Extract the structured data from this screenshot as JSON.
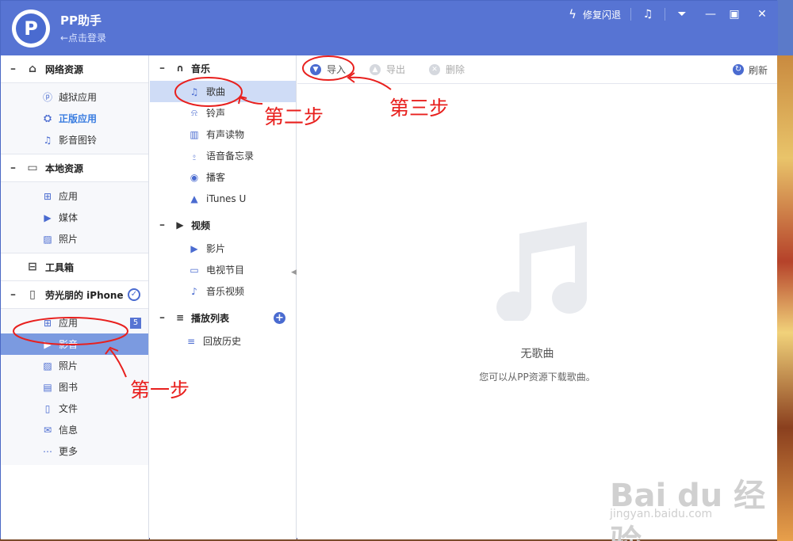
{
  "app": {
    "title": "PP助手",
    "login": "←点击登录"
  },
  "titlebar": {
    "flash_fix": "修复闪退"
  },
  "sidebar": {
    "sections": [
      {
        "label": "网络资源",
        "items": [
          "越狱应用",
          "正版应用",
          "影音图铃"
        ]
      },
      {
        "label": "本地资源",
        "items": [
          "应用",
          "媒体",
          "照片"
        ]
      },
      {
        "label": "工具箱"
      },
      {
        "label": "劳光朋的 iPhone",
        "items": [
          "应用",
          "影音",
          "照片",
          "图书",
          "文件",
          "信息",
          "更多"
        ],
        "apps_badge": "5"
      }
    ]
  },
  "categories": {
    "music": {
      "label": "音乐",
      "items": [
        "歌曲",
        "铃声",
        "有声读物",
        "语音备忘录",
        "播客",
        "iTunes U"
      ]
    },
    "video": {
      "label": "视频",
      "items": [
        "影片",
        "电视节目",
        "音乐视频"
      ]
    },
    "playlist": {
      "label": "播放列表",
      "items": [
        "回放历史"
      ]
    }
  },
  "toolbar": {
    "import": "导入",
    "export": "导出",
    "delete": "删除",
    "refresh": "刷新"
  },
  "empty": {
    "title": "无歌曲",
    "subtitle": "您可以从PP资源下载歌曲。"
  },
  "annotations": {
    "step1": "第一步",
    "step2": "第二步",
    "step3": "第三步"
  },
  "watermark": {
    "brand": "Bai du 经验",
    "url": "jingyan.baidu.com"
  },
  "colors": {
    "titlebar": "#5774d3",
    "accent": "#4a6bd0",
    "selected": "#7b9ae0",
    "annotation": "#e8201e"
  }
}
